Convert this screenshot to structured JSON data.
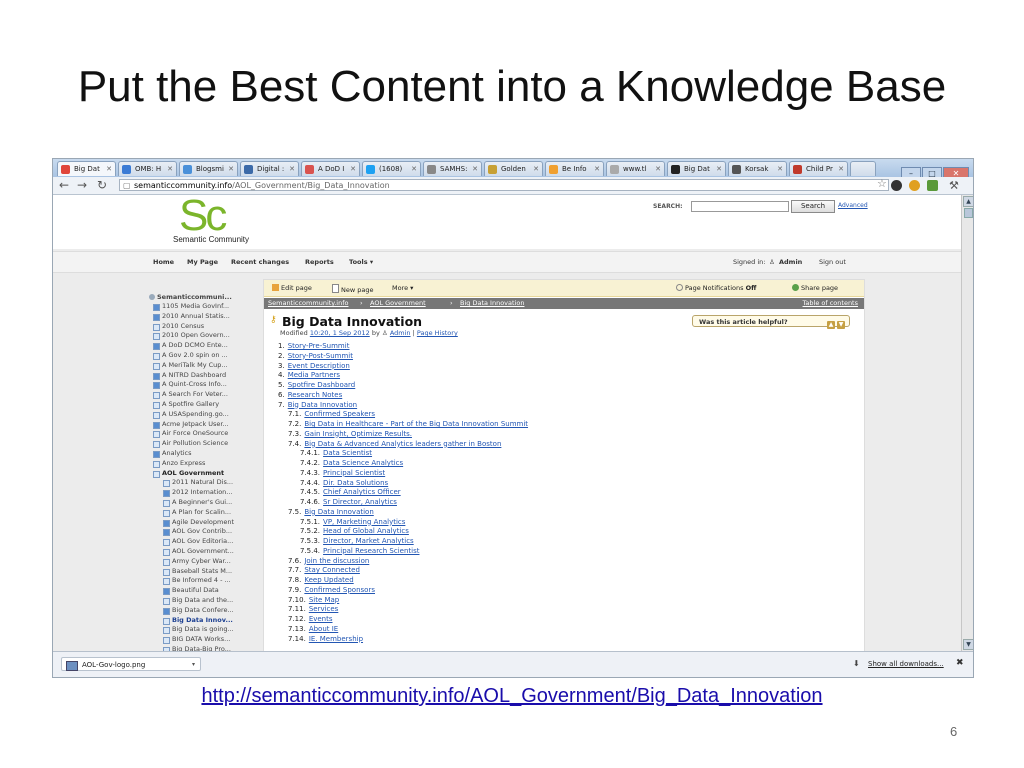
{
  "slide": {
    "title": "Put the Best Content into a Knowledge Base",
    "caption_link": "http://semanticcommunity.info/AOL_Government/Big_Data_Innovation",
    "page_number": "6"
  },
  "browser": {
    "tabs": [
      {
        "label": "Big Dat"
      },
      {
        "label": "OMB: H"
      },
      {
        "label": "Blogsmi"
      },
      {
        "label": "Digital :"
      },
      {
        "label": "A DoD I"
      },
      {
        "label": "(1608)"
      },
      {
        "label": "SAMHS:"
      },
      {
        "label": "Golden"
      },
      {
        "label": "Be Info"
      },
      {
        "label": "www.tl"
      },
      {
        "label": "Big Dat"
      },
      {
        "label": "Korsak"
      },
      {
        "label": "Child Pr"
      }
    ],
    "url_host": "semanticcommunity.info",
    "url_path": "/AOL_Government/Big_Data_Innovation"
  },
  "site": {
    "logo_text": "Sc",
    "logo_name": "Semantic Community",
    "search_label": "SEARCH:",
    "search_button": "Search",
    "advanced_link": "Advanced",
    "nav": [
      "Home",
      "My Page",
      "Recent changes",
      "Reports",
      "Tools ▾"
    ],
    "signed_in_label": "Signed in:",
    "user": "Admin",
    "sign_out": "Sign out"
  },
  "sidebar": {
    "root": "Semanticcommuni...",
    "items": [
      {
        "label": "1105 Media GovInf...",
        "indent": 0,
        "kind": "plus"
      },
      {
        "label": "2010 Annual Statis...",
        "indent": 0,
        "kind": "plus"
      },
      {
        "label": "2010 Census",
        "indent": 0,
        "kind": "doc"
      },
      {
        "label": "2010 Open Govern...",
        "indent": 0,
        "kind": "doc"
      },
      {
        "label": "A DoD DCMO Ente...",
        "indent": 0,
        "kind": "plus"
      },
      {
        "label": "A Gov 2.0 spin on ...",
        "indent": 0,
        "kind": "doc"
      },
      {
        "label": "A MeriTalk My Cup...",
        "indent": 0,
        "kind": "doc"
      },
      {
        "label": "A NITRD Dashboard",
        "indent": 0,
        "kind": "plus"
      },
      {
        "label": "A Quint-Cross Info...",
        "indent": 0,
        "kind": "plus"
      },
      {
        "label": "A Search For Veter...",
        "indent": 0,
        "kind": "doc"
      },
      {
        "label": "A Spotfire Gallery",
        "indent": 0,
        "kind": "doc"
      },
      {
        "label": "A USASpending.go...",
        "indent": 0,
        "kind": "doc"
      },
      {
        "label": "Acme Jetpack User...",
        "indent": 0,
        "kind": "plus"
      },
      {
        "label": "Air Force OneSource",
        "indent": 0,
        "kind": "doc"
      },
      {
        "label": "Air Pollution Science",
        "indent": 0,
        "kind": "doc"
      },
      {
        "label": "Analytics",
        "indent": 0,
        "kind": "plus"
      },
      {
        "label": "Anzo Express",
        "indent": 0,
        "kind": "doc"
      },
      {
        "label": "AOL Government",
        "indent": 0,
        "kind": "open",
        "bold": true
      },
      {
        "label": "2011 Natural Dis...",
        "indent": 1,
        "kind": "doc"
      },
      {
        "label": "2012 Internation...",
        "indent": 1,
        "kind": "plus"
      },
      {
        "label": "A Beginner's Gui...",
        "indent": 1,
        "kind": "doc"
      },
      {
        "label": "A Plan for Scalin...",
        "indent": 1,
        "kind": "doc"
      },
      {
        "label": "Agile Development",
        "indent": 1,
        "kind": "plus"
      },
      {
        "label": "AOL Gov Contrib...",
        "indent": 1,
        "kind": "plus"
      },
      {
        "label": "AOL Gov Editoria...",
        "indent": 1,
        "kind": "doc"
      },
      {
        "label": "AOL Government...",
        "indent": 1,
        "kind": "doc"
      },
      {
        "label": "Army Cyber War...",
        "indent": 1,
        "kind": "doc"
      },
      {
        "label": "Baseball Stats M...",
        "indent": 1,
        "kind": "doc"
      },
      {
        "label": "Be Informed 4 - ...",
        "indent": 1,
        "kind": "doc"
      },
      {
        "label": "Beautiful Data",
        "indent": 1,
        "kind": "plus"
      },
      {
        "label": "Big Data and the...",
        "indent": 1,
        "kind": "doc"
      },
      {
        "label": "Big Data Confere...",
        "indent": 1,
        "kind": "plus"
      },
      {
        "label": "Big Data Innov...",
        "indent": 1,
        "kind": "doc",
        "current": true
      },
      {
        "label": "Big Data is going...",
        "indent": 1,
        "kind": "doc"
      },
      {
        "label": "BIG DATA Works...",
        "indent": 1,
        "kind": "doc"
      },
      {
        "label": "Big Data-Big Pro...",
        "indent": 1,
        "kind": "doc"
      },
      {
        "label": "Build AOL Gov in...",
        "indent": 1,
        "kind": "doc"
      },
      {
        "label": "Build the NIEM IE...",
        "indent": 1,
        "kind": "plus"
      },
      {
        "label": "Building a Digital...",
        "indent": 1,
        "kind": "doc"
      }
    ]
  },
  "content": {
    "toolbar": {
      "edit": "Edit page",
      "new": "New page",
      "more": "More ▾",
      "notifications": "Page Notifications",
      "notifications_state": "Off",
      "share": "Share page"
    },
    "breadcrumbs": [
      "Semanticcommunity.info",
      "AOL Government",
      "Big Data Innovation"
    ],
    "toc_link": "Table of contents",
    "title": "Big Data Innovation",
    "modified_label": "Modified",
    "modified_time": "10:20, 1 Sep 2012",
    "modified_by": "by",
    "author": "Admin",
    "history": "Page History",
    "helpful": "Was this article helpful?",
    "toc": [
      {
        "num": "1.",
        "text": "Story-Pre-Summit",
        "level": 1
      },
      {
        "num": "2.",
        "text": "Story-Post-Summit",
        "level": 1
      },
      {
        "num": "3.",
        "text": "Event Description",
        "level": 1
      },
      {
        "num": "4.",
        "text": "Media Partners",
        "level": 1
      },
      {
        "num": "5.",
        "text": "Spotfire Dashboard",
        "level": 1
      },
      {
        "num": "6.",
        "text": "Research Notes",
        "level": 1
      },
      {
        "num": "7.",
        "text": "Big Data Innovation",
        "level": 1
      },
      {
        "num": "7.1.",
        "text": "Confirmed Speakers",
        "level": 2
      },
      {
        "num": "7.2.",
        "text": "Big Data in Healthcare - Part of the Big Data Innovation Summit",
        "level": 2
      },
      {
        "num": "7.3.",
        "text": "Gain Insight, Optimize Results.",
        "level": 2
      },
      {
        "num": "7.4.",
        "text": "Big Data & Advanced Analytics leaders gather in Boston",
        "level": 2
      },
      {
        "num": "7.4.1.",
        "text": "Data Scientist",
        "level": 3
      },
      {
        "num": "7.4.2.",
        "text": "Data Science Analytics",
        "level": 3
      },
      {
        "num": "7.4.3.",
        "text": "Principal Scientist",
        "level": 3
      },
      {
        "num": "7.4.4.",
        "text": "Dir. Data Solutions",
        "level": 3
      },
      {
        "num": "7.4.5.",
        "text": "Chief Analytics Officer",
        "level": 3
      },
      {
        "num": "7.4.6.",
        "text": "Sr Director, Analytics",
        "level": 3
      },
      {
        "num": "7.5.",
        "text": "Big Data Innovation",
        "level": 2
      },
      {
        "num": "7.5.1.",
        "text": "VP, Marketing Analytics",
        "level": 3
      },
      {
        "num": "7.5.2.",
        "text": "Head of Global Analytics",
        "level": 3
      },
      {
        "num": "7.5.3.",
        "text": "Director, Market Analytics",
        "level": 3
      },
      {
        "num": "7.5.4.",
        "text": "Principal Research Scientist",
        "level": 3
      },
      {
        "num": "7.6.",
        "text": "Join the discussion",
        "level": 2
      },
      {
        "num": "7.7.",
        "text": "Stay Connected",
        "level": 2
      },
      {
        "num": "7.8.",
        "text": "Keep Updated",
        "level": 2
      },
      {
        "num": "7.9.",
        "text": "Confirmed Sponsors",
        "level": 2
      },
      {
        "num": "7.10.",
        "text": "Site Map",
        "level": 2
      },
      {
        "num": "7.11.",
        "text": "Services",
        "level": 2
      },
      {
        "num": "7.12.",
        "text": "Events",
        "level": 2
      },
      {
        "num": "7.13.",
        "text": "About IE",
        "level": 2
      },
      {
        "num": "7.14.",
        "text": "IE. Membership",
        "level": 2
      }
    ]
  },
  "downloads": {
    "file": "AOL-Gov-logo.png",
    "show_all": "Show all downloads...",
    "close": "✖"
  },
  "colors": {
    "brand_green": "#7bb52b",
    "link": "#2256b3"
  }
}
